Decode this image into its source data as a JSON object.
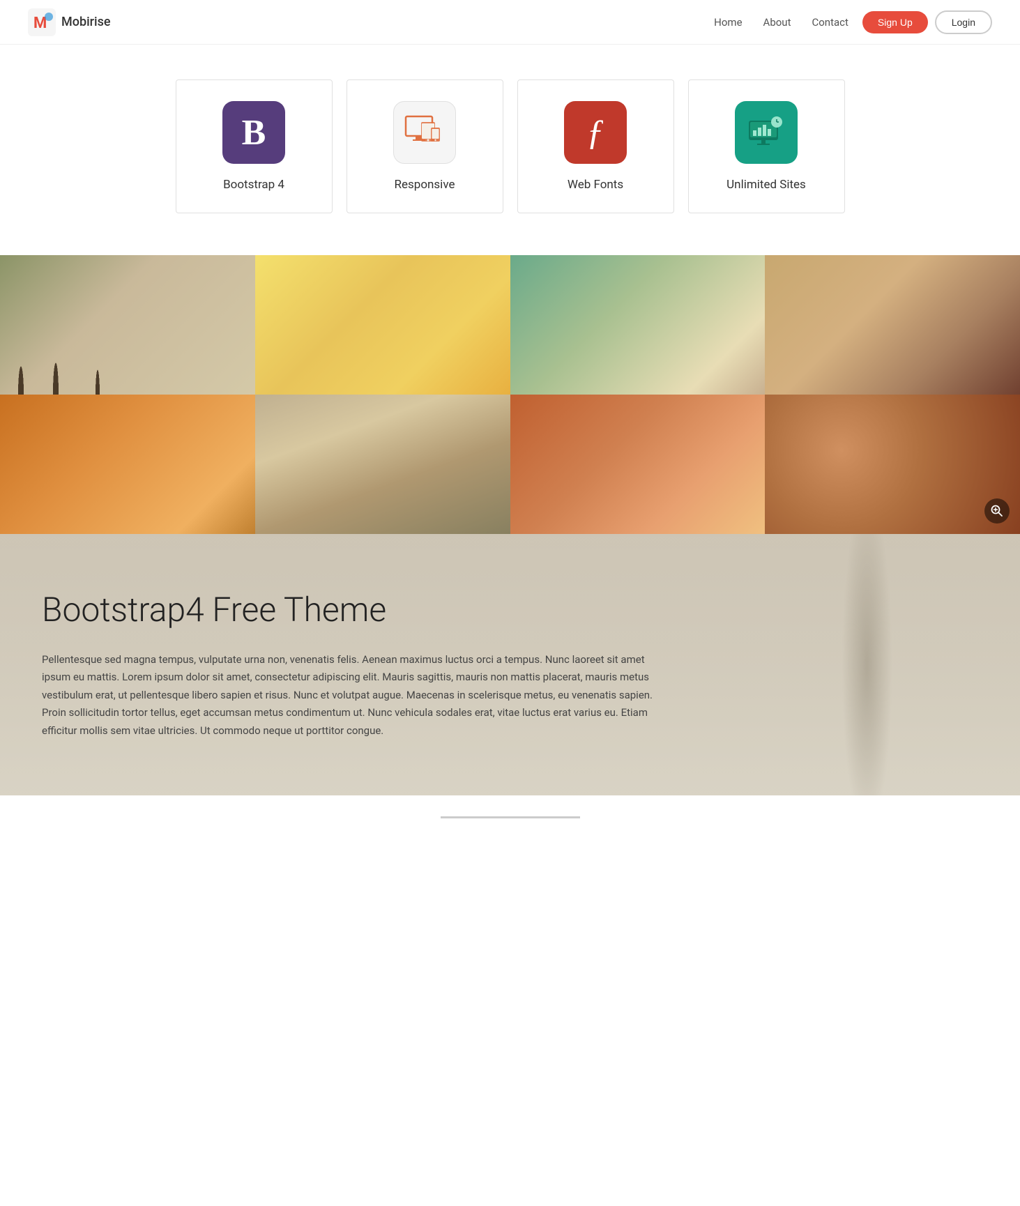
{
  "brand": {
    "name": "Mobirise"
  },
  "nav": {
    "links": [
      "Home",
      "About",
      "Contact"
    ],
    "signup_label": "Sign Up",
    "login_label": "Login"
  },
  "features": [
    {
      "id": "bootstrap",
      "label": "Bootstrap 4",
      "icon_type": "bootstrap"
    },
    {
      "id": "responsive",
      "label": "Responsive",
      "icon_type": "responsive"
    },
    {
      "id": "webfonts",
      "label": "Web Fonts",
      "icon_type": "webfonts"
    },
    {
      "id": "unlimited",
      "label": "Unlimited Sites",
      "icon_type": "unlimited"
    }
  ],
  "content": {
    "title": "Bootstrap4 Free Theme",
    "body": "Pellentesque sed magna tempus, vulputate urna non, venenatis felis. Aenean maximus luctus orci a tempus. Nunc laoreet sit amet ipsum eu mattis. Lorem ipsum dolor sit amet, consectetur adipiscing elit. Mauris sagittis, mauris non mattis placerat, mauris metus vestibulum erat, ut pellentesque libero sapien et risus. Nunc et volutpat augue. Maecenas in scelerisque metus, eu venenatis sapien. Proin sollicitudin tortor tellus, eget accumsan metus condimentum ut. Nunc vehicula sodales erat, vitae luctus erat varius eu. Etiam efficitur mollis sem vitae ultricies. Ut commodo neque ut porttitor congue."
  }
}
